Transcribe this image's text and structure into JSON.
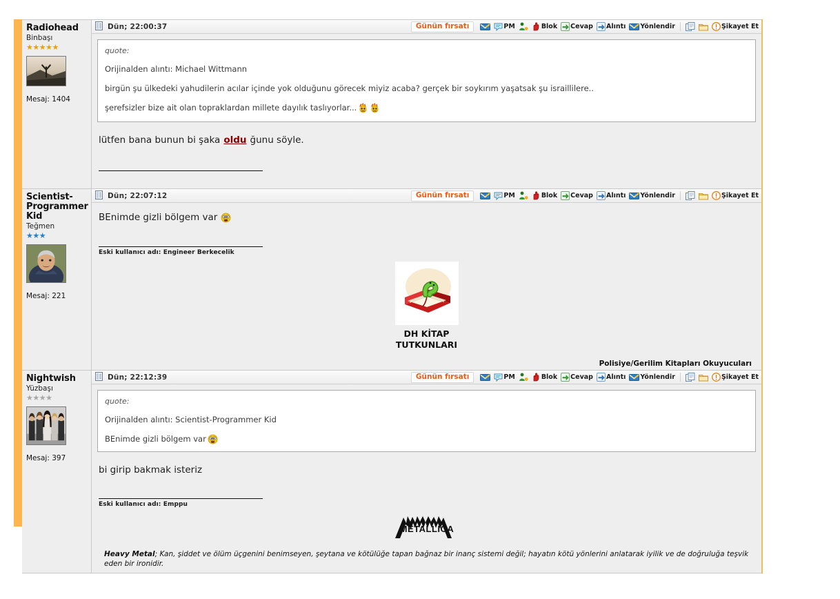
{
  "page": {
    "accent_orange": "#fcb64d",
    "badge_color": "#f05a12",
    "background": "#eeeeee"
  },
  "toolbar": {
    "deal_label": "Günün fırsatı",
    "items": [
      {
        "icon": "mail-icon",
        "label": ""
      },
      {
        "icon": "pm-icon",
        "label": "PM"
      },
      {
        "icon": "user-add-icon",
        "label": ""
      },
      {
        "icon": "block-hand-icon",
        "label": "Blok"
      },
      {
        "icon": "reply-icon",
        "label": "Cevap"
      },
      {
        "icon": "quote-icon",
        "label": "Alıntı"
      },
      {
        "icon": "forward-icon",
        "label": "Yönlendir"
      },
      {
        "icon": "copy-icon",
        "label": ""
      },
      {
        "icon": "folder-icon",
        "label": ""
      },
      {
        "icon": "report-icon",
        "label": "Şikayet Et"
      }
    ]
  },
  "posts": [
    {
      "user": {
        "name": "Radiohead",
        "rank": "Binbaşı",
        "star_count": 5,
        "star_color": "orange",
        "message_label": "Mesaj: 1404",
        "avatar": "radiohead-album-art"
      },
      "date": "Dün; 22:00:37",
      "quote": {
        "label": "quote:",
        "attribution": "Orijinalden alıntı: Michael Wittmann",
        "lines": [
          "birgün şu ülkedeki yahudilerin acılar içinde yok olduğunu görecek miyiz acaba? gerçek bir soykırım yaşatsak şu israillilere..",
          "şerefsizler bize ait olan topraklardan millete dayılık taslıyorlar..."
        ],
        "emoticons": [
          "angry-flame-emoticon",
          "angry-flame-emoticon"
        ]
      },
      "body_pre": "lütfen bana bunun bi şaka ",
      "body_highlight": "oldu",
      "body_post": "ğunu söyle."
    },
    {
      "user": {
        "name": "Scientist-Programmer Kid",
        "rank": "Teğmen",
        "star_count": 3,
        "star_color": "blue",
        "message_label": "Mesaj: 221",
        "avatar": "carl-sagan-portrait"
      },
      "date": "Dün; 22:07:12",
      "body": "BEnimde gizli bölgem var",
      "body_emoticon": "crazy-eyes-emoticon",
      "signature_note": "Eski kullanıcı adı:  Engineer Berkecelik",
      "banner": {
        "image": "bookworm-on-red-book",
        "caption_line1": "DH KİTAP",
        "caption_line2": "TUTKUNLARI"
      },
      "club_line": "Polisiye/Gerilim Kitapları Okuyucuları"
    },
    {
      "user": {
        "name": "Nightwish",
        "rank": "Yüzbaşı",
        "star_count": 4,
        "star_color": "grey",
        "message_label": "Mesaj: 397",
        "avatar": "nightwish-band-photo"
      },
      "date": "Dün; 22:12:39",
      "quote": {
        "label": "quote:",
        "attribution": "Orijinalden alıntı: Scientist-Programmer Kid",
        "lines": [
          "BEnimde gizli bölgem var"
        ],
        "emoticons": [
          "crazy-eyes-emoticon"
        ]
      },
      "body": "bi girip bakmak isteriz",
      "signature_note": "Eski kullanıcı adı:  Emppu",
      "banner": {
        "image": "metallica-logo"
      },
      "heavy_bold": "Heavy Metal",
      "heavy_rest": "; Kan, şiddet ve ölüm üçgenini benimseyen, şeytana ve kötülüğe tapan bağnaz bir inanç sistemi değil; hayatın kötü yönlerini anlatarak iyilik ve de doğruluğa teşvik eden bir ironidir."
    }
  ]
}
